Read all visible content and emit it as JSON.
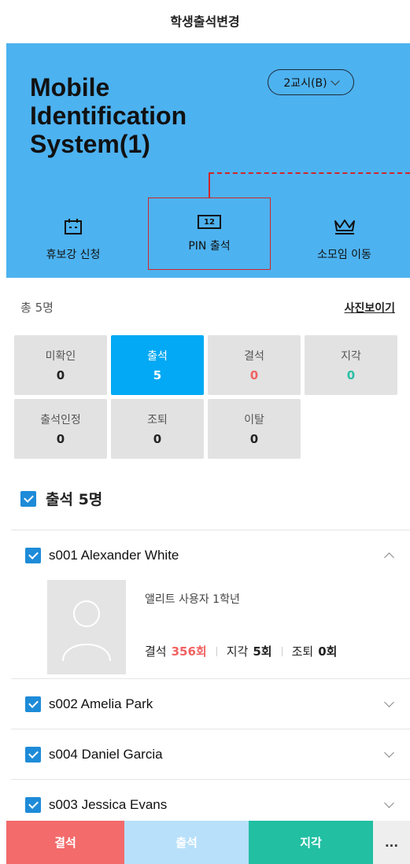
{
  "header": {
    "title": "학생출석변경"
  },
  "hero": {
    "system_title": "Mobile Identification System(1)",
    "period_label": "2교시(B)",
    "actions": [
      {
        "label": "휴보강 신청",
        "icon": "calendar-icon"
      },
      {
        "label": "PIN 출석",
        "icon": "pin-keypad-icon",
        "pin_glyph": "12"
      },
      {
        "label": "소모임 이동",
        "icon": "crown-icon"
      }
    ]
  },
  "summary": {
    "total": "총 5명",
    "photo_toggle": "사진보이기",
    "cells": [
      {
        "label": "미확인",
        "count": "0"
      },
      {
        "label": "출석",
        "count": "5"
      },
      {
        "label": "결석",
        "count": "0"
      },
      {
        "label": "지각",
        "count": "0"
      },
      {
        "label": "출석인정",
        "count": "0"
      },
      {
        "label": "조퇴",
        "count": "0"
      },
      {
        "label": "이탈",
        "count": "0"
      }
    ]
  },
  "section": {
    "label": "출석 5명"
  },
  "students": [
    {
      "name": "s001 Alexander White",
      "info": "앨리트 사용자 1학년",
      "absent_label": "결석",
      "absent_value": "356회",
      "late_label": "지각",
      "late_value": "5회",
      "early_label": "조퇴",
      "early_value": "0회"
    },
    {
      "name": "s002 Amelia Park"
    },
    {
      "name": "s004 Daniel Garcia"
    },
    {
      "name": "s003 Jessica Evans"
    }
  ],
  "bottom": {
    "absent": "결석",
    "present": "출석",
    "late": "지각",
    "more": "..."
  },
  "colors": {
    "hero_bg": "#4db2f0",
    "active_cell": "#03a9f4",
    "absent_red": "#f36b6b",
    "late_green": "#22bfa3",
    "highlight_border": "#d0262b"
  }
}
